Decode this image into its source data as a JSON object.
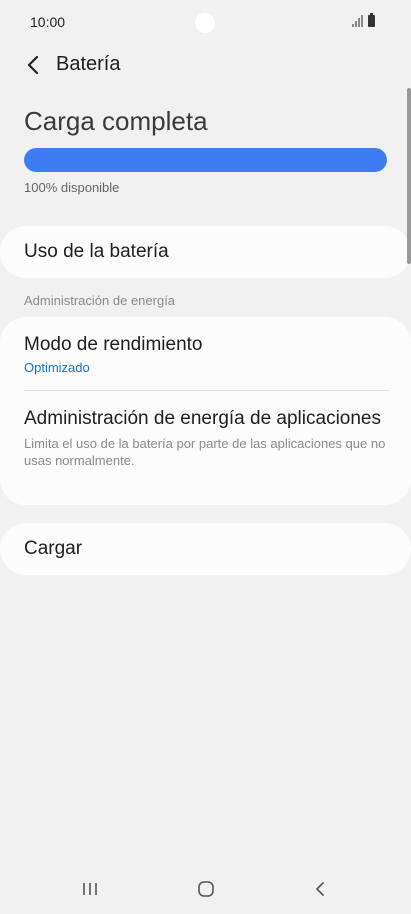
{
  "status_bar": {
    "time": "10:00"
  },
  "header": {
    "title": "Batería"
  },
  "battery": {
    "status_title": "Carga completa",
    "level_fraction": 1.0,
    "level_text": "100% disponible",
    "bar_color": "#3e7cf4"
  },
  "usage_card": {
    "label": "Uso de la batería"
  },
  "power_section": {
    "header": "Administración de energía",
    "items": [
      {
        "title": "Modo de rendimiento",
        "value": "Optimizado"
      },
      {
        "title": "Administración de energía de aplicaciones",
        "description": "Limita el uso de la batería por parte de las aplicaciones que no usas normalmente."
      }
    ]
  },
  "charge_card": {
    "label": "Cargar"
  },
  "icons": {
    "back": "chevron-left-icon",
    "signal": "signal-icon",
    "battery": "battery-icon",
    "recents": "recents-icon",
    "home": "home-icon",
    "nav_back": "back-icon"
  },
  "colors": {
    "accent": "#1a73c7",
    "background": "#f1f1f1",
    "card": "#fcfcfc"
  }
}
